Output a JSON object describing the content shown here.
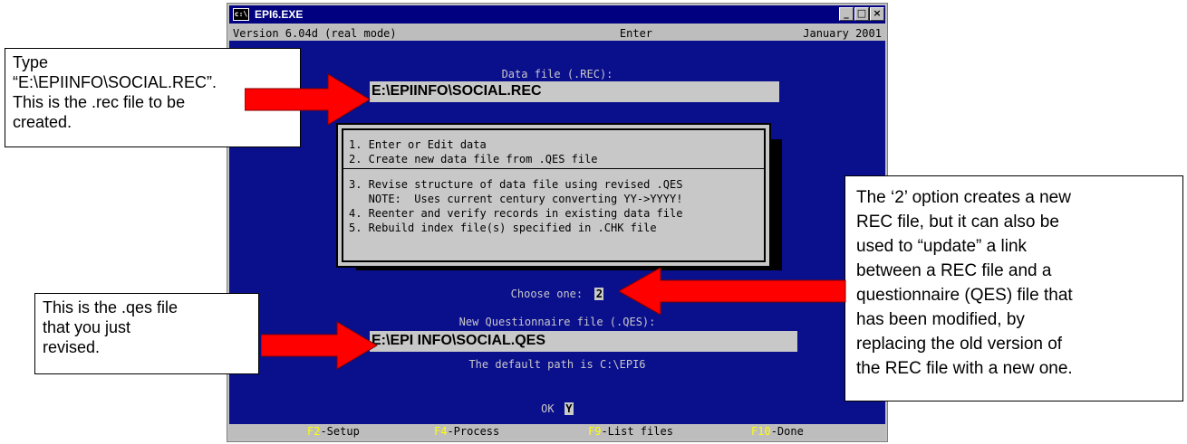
{
  "window": {
    "title": "EPI6.EXE",
    "minimize": "_",
    "maximize": "□",
    "close": "×"
  },
  "status": {
    "version": "Version 6.04d (real mode)",
    "mode": "Enter",
    "date": "January 2001"
  },
  "data_file": {
    "label": "Data file (.REC):",
    "value": "E:\\EPIINFO\\SOCIAL.REC"
  },
  "menu": {
    "items": [
      "1. Enter or Edit data",
      "2. Create new data file from .QES file",
      "3. Revise structure of data file using revised .QES",
      "   NOTE:  Uses current century converting YY->YYYY!",
      "4. Reenter and verify records in existing data file",
      "5. Rebuild index file(s) specified in .CHK file"
    ]
  },
  "choose": {
    "label": "Choose one:",
    "value": "2"
  },
  "qes_file": {
    "label": "New Questionnaire file (.QES):",
    "value": "E:\\EPI INFO\\SOCIAL.QES"
  },
  "default_path": "The default path is C:\\EPI6",
  "ok": {
    "label": "OK",
    "value": "Y"
  },
  "function_keys": [
    {
      "key": "F2",
      "label": "-Setup"
    },
    {
      "key": "F4",
      "label": "-Process"
    },
    {
      "key": "F9",
      "label": "-List files"
    },
    {
      "key": "F10",
      "label": "-Done"
    }
  ],
  "callouts": {
    "rec_file": [
      "Type",
      "“E:\\EPIINFO\\SOCIAL.REC”.",
      "This is the .rec file to be",
      "created."
    ],
    "qes_file": [
      "This is the .qes file",
      "that you just",
      "revised."
    ],
    "option2": [
      "The ‘2’ option creates a new",
      "REC file, but it can also be",
      "used to “update” a link",
      "between a REC file and a",
      "questionnaire (QES) file that",
      "has been modified, by",
      "replacing the old version of",
      "the REC file with a new one."
    ]
  },
  "colors": {
    "screen_bg": "#0a0f8c",
    "field_bg": "#c8c8c8",
    "arrow": "#ff0000",
    "fkey": "#ffff00"
  }
}
